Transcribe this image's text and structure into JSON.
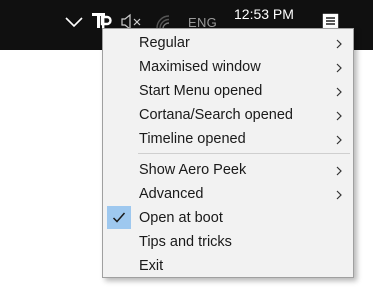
{
  "taskbar": {
    "language": "ENG",
    "clock": "12:53 PM",
    "icons": [
      "chevron-up-icon",
      "tray-app-icon",
      "volume-muted-icon",
      "network-icon",
      "notification-icon"
    ]
  },
  "menu": {
    "items": [
      {
        "label": "Regular",
        "submenu": true
      },
      {
        "label": "Maximised window",
        "submenu": true
      },
      {
        "label": "Start Menu opened",
        "submenu": true
      },
      {
        "label": "Cortana/Search opened",
        "submenu": true
      },
      {
        "label": "Timeline opened",
        "submenu": true
      },
      {
        "label": "Show Aero Peek",
        "submenu": true
      },
      {
        "label": "Advanced",
        "submenu": true
      },
      {
        "label": "Open at boot",
        "checked": true
      },
      {
        "label": "Tips and tricks"
      },
      {
        "label": "Exit"
      }
    ]
  },
  "colors": {
    "taskbar": "#101010",
    "menu_bg": "#f2f2f2",
    "check_highlight": "#9ec8ef"
  }
}
